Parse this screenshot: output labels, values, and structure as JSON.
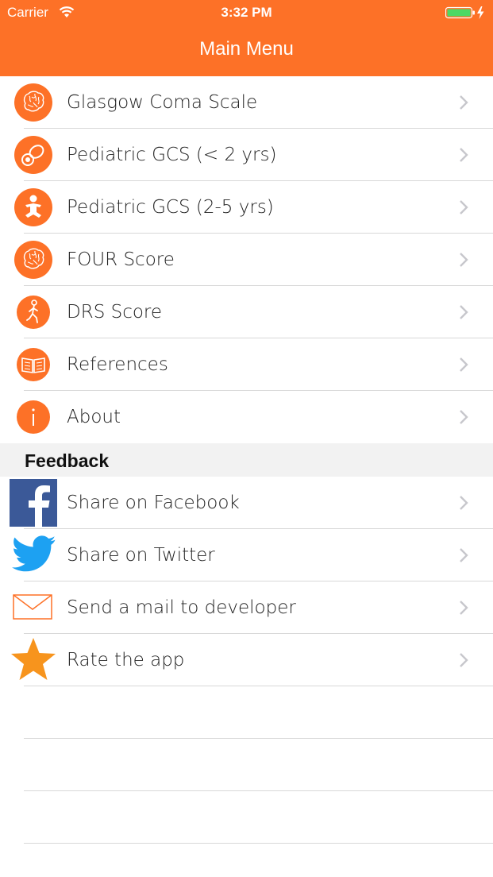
{
  "status_bar": {
    "carrier": "Carrier",
    "time": "3:32 PM",
    "battery_color": "#4cd964"
  },
  "nav": {
    "title": "Main Menu"
  },
  "accent_color": "#fd7127",
  "menu": {
    "items": [
      {
        "label": "Glasgow Coma Scale",
        "icon": "brain-icon"
      },
      {
        "label": "Pediatric GCS (< 2 yrs)",
        "icon": "pacifier-icon"
      },
      {
        "label": "Pediatric GCS (2-5 yrs)",
        "icon": "toddler-icon"
      },
      {
        "label": "FOUR Score",
        "icon": "brain-icon"
      },
      {
        "label": "DRS Score",
        "icon": "walking-person-icon"
      },
      {
        "label": "References",
        "icon": "book-icon"
      },
      {
        "label": "About",
        "icon": "info-icon"
      }
    ]
  },
  "feedback": {
    "header": "Feedback",
    "items": [
      {
        "label": "Share on Facebook",
        "icon": "facebook-icon"
      },
      {
        "label": "Share on Twitter",
        "icon": "twitter-icon"
      },
      {
        "label": "Send a mail to developer",
        "icon": "mail-icon"
      },
      {
        "label": "Rate the app",
        "icon": "star-icon"
      }
    ]
  }
}
